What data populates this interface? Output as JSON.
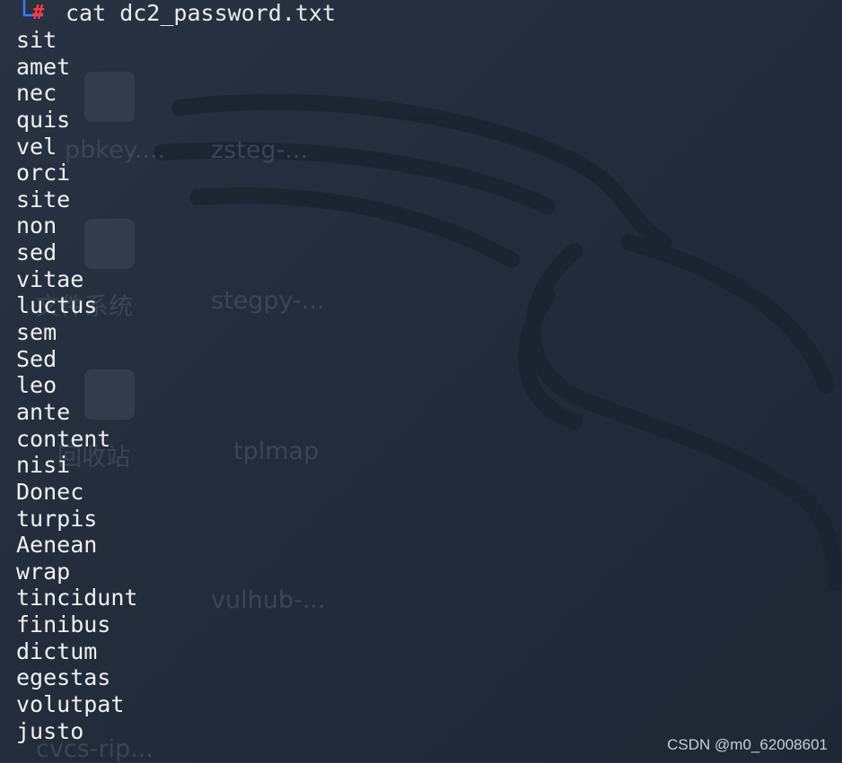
{
  "terminal": {
    "prompt_symbol": "#",
    "command": "cat dc2_password.txt",
    "output_lines": [
      "sit",
      "amet",
      "nec",
      "quis",
      "vel",
      "orci",
      "site",
      "non",
      "sed",
      "vitae",
      "luctus",
      "sem",
      "Sed",
      "leo",
      "ante",
      "content",
      "nisi",
      "Donec",
      "turpis",
      "Aenean",
      "wrap",
      "tincidunt",
      "finibus",
      "dictum",
      "egestas",
      "volutpat",
      "justo"
    ]
  },
  "desktop_background": {
    "icon_labels": [
      "pbkey....",
      "zsteg-...",
      "文件系统",
      "stegpy-...",
      "回收站",
      "tplmap",
      "vulhub-...",
      "cvcs-rip..."
    ]
  },
  "watermark": "CSDN @m0_62008601",
  "colors": {
    "background": "#232c3b",
    "text": "#eef1f5",
    "prompt_hash": "#ff3b3b",
    "prompt_bracket": "#3a7bff"
  }
}
